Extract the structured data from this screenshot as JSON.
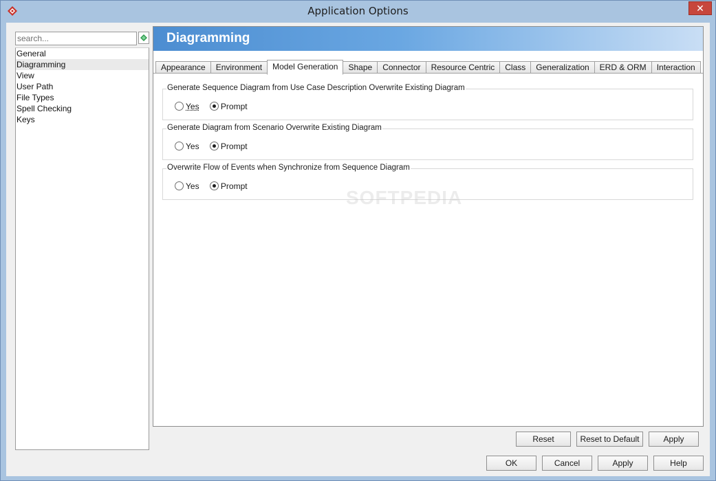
{
  "window": {
    "title": "Application Options",
    "close_glyph": "✕"
  },
  "sidebar": {
    "search_placeholder": "search...",
    "items": [
      {
        "label": "General"
      },
      {
        "label": "Diagramming",
        "selected": true
      },
      {
        "label": "View"
      },
      {
        "label": "User Path"
      },
      {
        "label": "File Types"
      },
      {
        "label": "Spell Checking"
      },
      {
        "label": "Keys"
      }
    ]
  },
  "main": {
    "heading": "Diagramming",
    "tabs": [
      {
        "label": "Appearance"
      },
      {
        "label": "Environment"
      },
      {
        "label": "Model Generation",
        "active": true
      },
      {
        "label": "Shape"
      },
      {
        "label": "Connector"
      },
      {
        "label": "Resource Centric"
      },
      {
        "label": "Class"
      },
      {
        "label": "Generalization"
      },
      {
        "label": "ERD & ORM"
      },
      {
        "label": "Interaction"
      }
    ],
    "groups": [
      {
        "title": "Generate Sequence Diagram from Use Case Description Overwrite Existing Diagram",
        "yes": "Yes",
        "prompt": "Prompt",
        "selected": "Prompt"
      },
      {
        "title": "Generate Diagram from Scenario Overwrite Existing Diagram",
        "yes": "Yes",
        "prompt": "Prompt",
        "selected": "Prompt"
      },
      {
        "title": "Overwrite Flow of Events when Synchronize from Sequence Diagram",
        "yes": "Yes",
        "prompt": "Prompt",
        "selected": "Prompt"
      }
    ],
    "watermark": "SOFTPEDIA"
  },
  "panel_buttons": {
    "reset": "Reset",
    "reset_default": "Reset to Default",
    "apply": "Apply"
  },
  "dialog_buttons": {
    "ok": "OK",
    "cancel": "Cancel",
    "apply": "Apply",
    "help": "Help"
  },
  "colors": {
    "banner": "#4c8dd1",
    "titlebar": "#a9c4e0",
    "close": "#c7463c"
  }
}
